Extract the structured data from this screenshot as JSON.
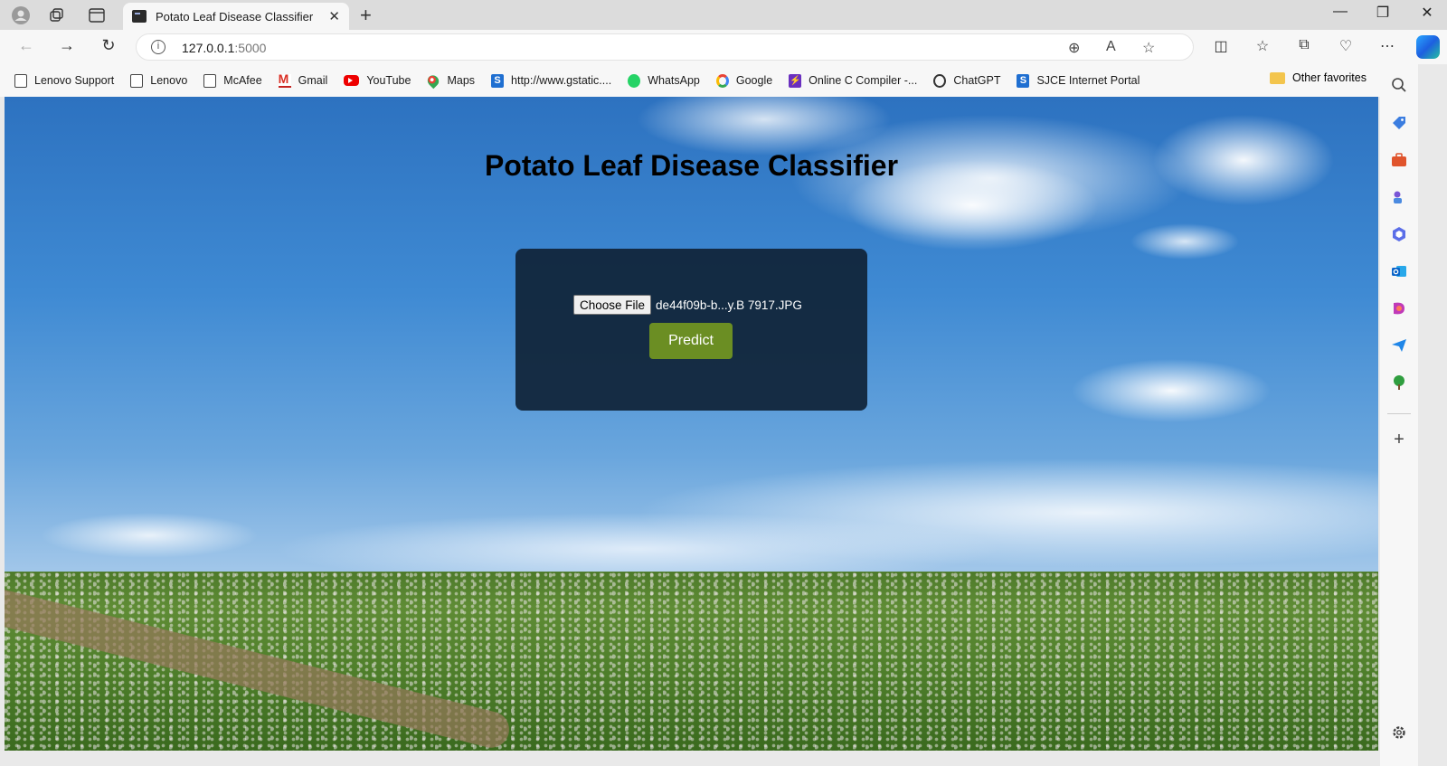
{
  "browser": {
    "tab": {
      "title": "Potato Leaf Disease Classifier"
    },
    "address": {
      "host": "127.0.0.1",
      "port": ":5000"
    },
    "bookmarks": [
      {
        "label": "Lenovo Support",
        "icon": "page-icon"
      },
      {
        "label": "Lenovo",
        "icon": "page-icon"
      },
      {
        "label": "McAfee",
        "icon": "page-icon"
      },
      {
        "label": "Gmail",
        "icon": "gmail-icon"
      },
      {
        "label": "YouTube",
        "icon": "youtube-icon"
      },
      {
        "label": "Maps",
        "icon": "maps-icon"
      },
      {
        "label": "http://www.gstatic....",
        "icon": "s-icon"
      },
      {
        "label": "WhatsApp",
        "icon": "whatsapp-icon"
      },
      {
        "label": "Google",
        "icon": "google-icon"
      },
      {
        "label": "Online C Compiler -...",
        "icon": "compiler-icon"
      },
      {
        "label": "ChatGPT",
        "icon": "chatgpt-icon"
      },
      {
        "label": "SJCE Internet Portal",
        "icon": "s-icon"
      }
    ],
    "other_favorites": "Other favorites"
  },
  "page": {
    "title": "Potato Leaf Disease Classifier",
    "file_input": {
      "button_label": "Choose File",
      "selected_file": "de44f09b-b...y.B 7917.JPG"
    },
    "predict_label": "Predict"
  },
  "colors": {
    "card_bg": "#102438",
    "predict_bg": "#6b8e23"
  }
}
